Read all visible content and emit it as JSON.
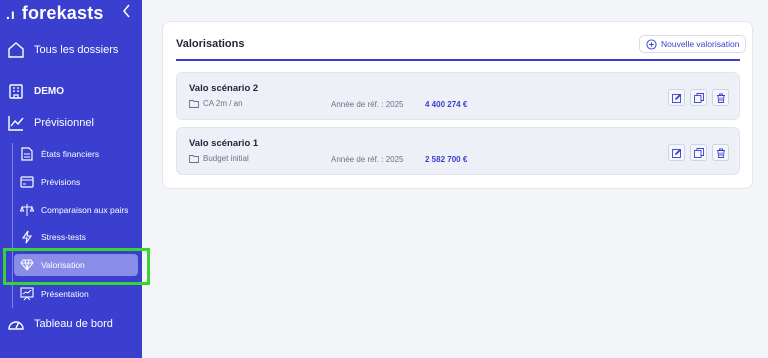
{
  "sidebar": {
    "logo_mark": ".ı",
    "logo_text": "forekasts",
    "items": [
      {
        "label": "Tous les dossiers",
        "icon": "home-icon"
      },
      {
        "label": "DEMO",
        "icon": "building-icon"
      },
      {
        "label": "Prévisionnel",
        "icon": "chart-line-icon"
      },
      {
        "label": "États financiers",
        "icon": "document-icon"
      },
      {
        "label": "Prévisions",
        "icon": "wallet-icon"
      },
      {
        "label": "Comparaison aux pairs",
        "icon": "compare-icon"
      },
      {
        "label": "Stress-tests",
        "icon": "lightning-icon"
      },
      {
        "label": "Valorisation",
        "icon": "diamond-icon"
      },
      {
        "label": "Présentation",
        "icon": "presentation-icon"
      },
      {
        "label": "Tableau de bord",
        "icon": "gauge-icon"
      }
    ],
    "active_item": "Valorisation"
  },
  "main": {
    "title": "Valorisations",
    "new_button_label": "Nouvelle valorisation",
    "rows": [
      {
        "name": "Valo scénario 2",
        "source": "CA 2m / an",
        "year_label": "Année de réf. : 2025",
        "amount": "4 400 274 €"
      },
      {
        "name": "Valo scénario 1",
        "source": "Budget initial",
        "year_label": "Année de réf. : 2025",
        "amount": "2 582 700 €"
      }
    ]
  },
  "colors": {
    "sidebar_bg": "#3a3fcf",
    "accent": "#3a3fcf",
    "highlight_outline": "#37d534",
    "active_item_bg": "#8a8de8"
  }
}
